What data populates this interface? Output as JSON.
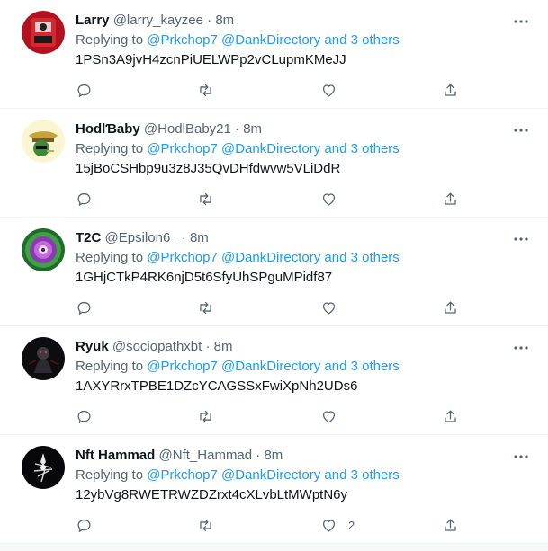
{
  "tweets": [
    {
      "name": "Larry",
      "handle": "@larry_kayzee",
      "dot": "·",
      "time": "8m",
      "replying_prefix": "Replying to ",
      "replying_links": "@Prkchop7 @DankDirectory and 3 others",
      "text": "1PSn3A9jvH4zcnPiUELWPp2vCLupmKMeJJ",
      "like_count": ""
    },
    {
      "name": "HodlƁaby",
      "handle": "@HodlBaby21",
      "dot": "·",
      "time": "8m",
      "replying_prefix": "Replying to ",
      "replying_links": "@Prkchop7 @DankDirectory and 3 others",
      "text": "15jBoCSHbp9u3z8J35QvDHfdwvw5VLiDdR",
      "like_count": ""
    },
    {
      "name": "T2C",
      "handle": "@Epsilon6_",
      "dot": "·",
      "time": "8m",
      "replying_prefix": "Replying to ",
      "replying_links": "@Prkchop7 @DankDirectory and 3 others",
      "text": "1GHjCTkP4RK6njD5t6SfyUhSPguMPidf87",
      "like_count": ""
    },
    {
      "name": "Ryuk",
      "handle": "@sociopathxbt",
      "dot": "·",
      "time": "8m",
      "replying_prefix": "Replying to ",
      "replying_links": "@Prkchop7 @DankDirectory and 3 others",
      "text": "1AXYRrxTPBE1DZcYCAGSSxFwiXpNh2UDs6",
      "like_count": ""
    },
    {
      "name": "Nft Hammad",
      "handle": "@Nft_Hammad",
      "dot": "·",
      "time": "8m",
      "replying_prefix": "Replying to ",
      "replying_links": "@Prkchop7 @DankDirectory and 3 others",
      "text": "12ybVg8RWETRWZDZrxt4cXLvbLtMWptN6y",
      "like_count": "2"
    }
  ],
  "icons": {
    "more": "more-icon",
    "reply": "reply-icon",
    "retweet": "retweet-icon",
    "like": "heart-icon",
    "share": "share-icon"
  },
  "colors": {
    "link": "#1d9bf0",
    "secondary_text": "#536471",
    "primary_text": "#0f1419",
    "divider": "#eff3f4"
  }
}
